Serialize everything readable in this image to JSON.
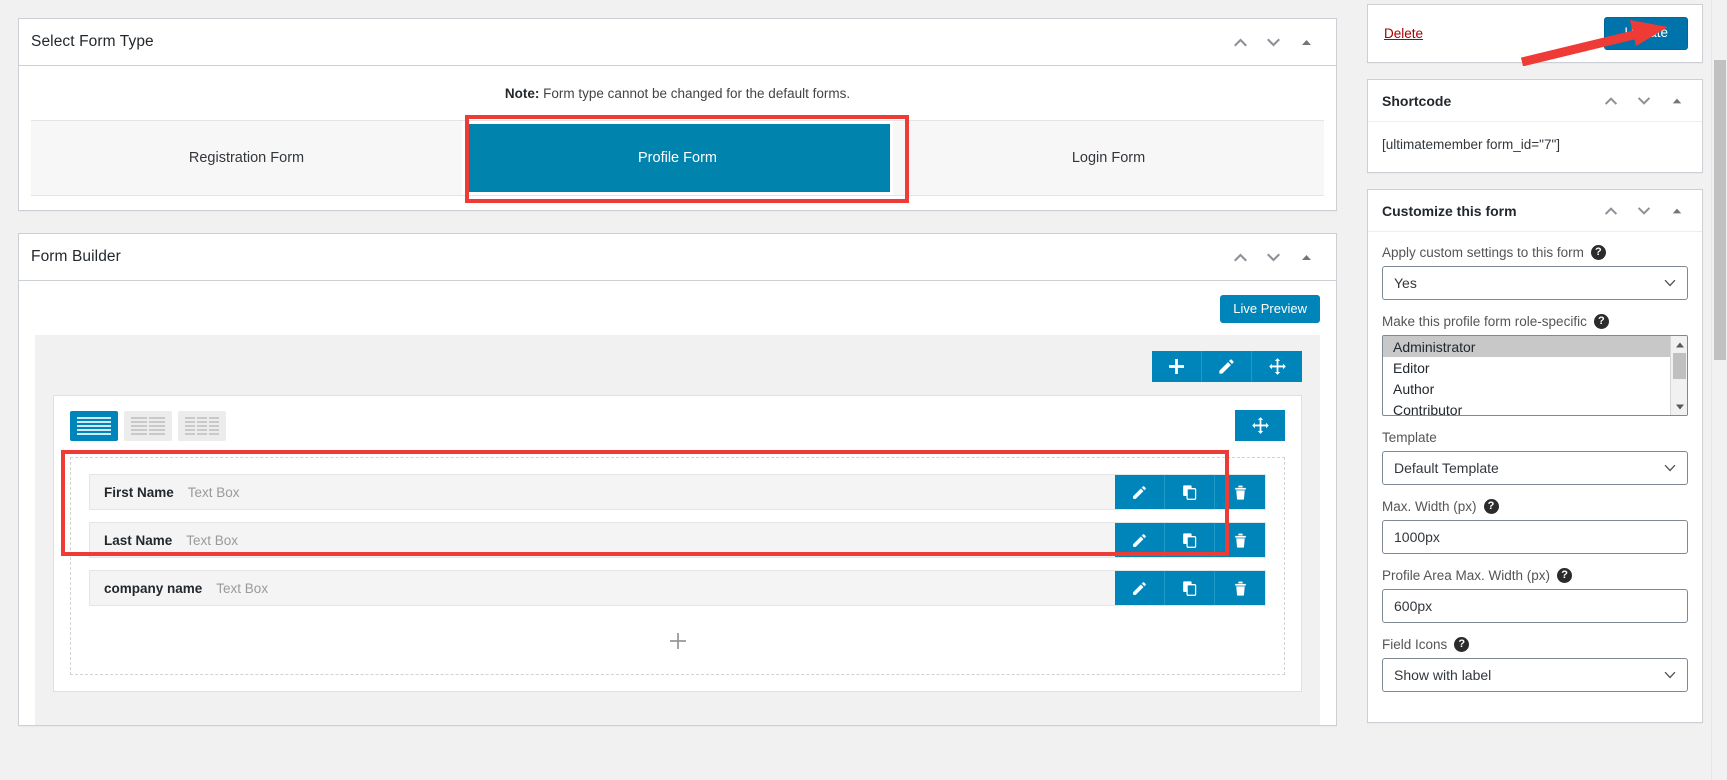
{
  "colors": {
    "accent_blue": "#0085ba",
    "update_blue": "#0073aa",
    "highlight_red": "#ef3b36",
    "delete_red": "#a00000"
  },
  "main": {
    "form_type_panel": {
      "title": "Select Form Type",
      "note_prefix": "Note:",
      "note_text": "Form type cannot be changed for the default forms.",
      "tabs": [
        {
          "label": "Registration Form",
          "active": false
        },
        {
          "label": "Profile Form",
          "active": true
        },
        {
          "label": "Login Form",
          "active": false
        }
      ]
    },
    "form_builder_panel": {
      "title": "Form Builder",
      "live_preview_label": "Live Preview",
      "row_toolbar": [
        {
          "icon": "plus-icon",
          "name": "add-row-button"
        },
        {
          "icon": "pencil-icon",
          "name": "edit-row-button"
        },
        {
          "icon": "move-icon",
          "name": "drag-row-button"
        }
      ],
      "column_layouts": [
        {
          "name": "one-column-layout",
          "segments": 1,
          "active": true
        },
        {
          "name": "two-column-layout",
          "segments": 2,
          "active": false
        },
        {
          "name": "three-column-layout",
          "segments": 3,
          "active": false
        }
      ],
      "fields": [
        {
          "label": "First Name",
          "type": "Text Box",
          "highlighted": true
        },
        {
          "label": "Last Name",
          "type": "Text Box",
          "highlighted": true
        },
        {
          "label": "company name",
          "type": "Text Box",
          "highlighted": false
        }
      ],
      "field_actions": [
        "edit-field-icon",
        "duplicate-field-icon",
        "delete-field-icon"
      ],
      "add_field_icon": "plus-icon"
    }
  },
  "sidebar": {
    "submit_box": {
      "delete_label": "Delete",
      "update_label": "Update"
    },
    "shortcode_panel": {
      "title": "Shortcode",
      "value": "[ultimatemember form_id=\"7\"]"
    },
    "customize_panel": {
      "title": "Customize this form",
      "settings": [
        {
          "kind": "select",
          "label": "Apply custom settings to this form",
          "has_help": true,
          "value": "Yes"
        },
        {
          "kind": "multiselect",
          "label": "Make this profile form role-specific",
          "has_help": true,
          "options": [
            {
              "label": "Administrator",
              "selected": true
            },
            {
              "label": "Editor",
              "selected": false
            },
            {
              "label": "Author",
              "selected": false
            },
            {
              "label": "Contributor",
              "selected": false
            }
          ]
        },
        {
          "kind": "select",
          "label": "Template",
          "has_help": false,
          "value": "Default Template"
        },
        {
          "kind": "text",
          "label": "Max. Width (px)",
          "has_help": true,
          "value": "1000px"
        },
        {
          "kind": "text",
          "label": "Profile Area Max. Width (px)",
          "has_help": true,
          "value": "600px"
        },
        {
          "kind": "select",
          "label": "Field Icons",
          "has_help": true,
          "value": "Show with label"
        }
      ]
    }
  },
  "panel_controls": {
    "move_up": "chevron-up-icon",
    "move_down": "chevron-down-icon",
    "toggle": "triangle-up-icon"
  },
  "help_glyph": "?"
}
